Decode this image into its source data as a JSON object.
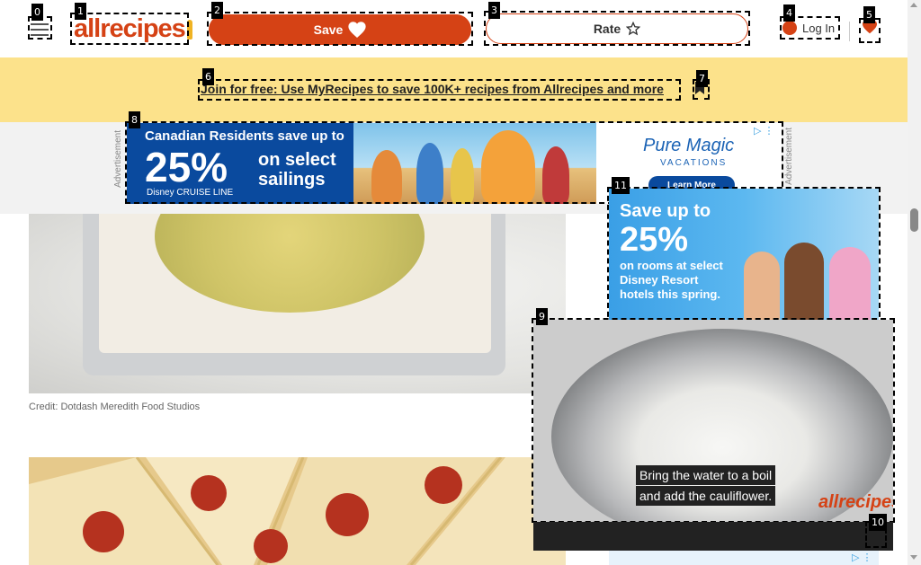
{
  "header": {
    "logo_text": "allrecipes",
    "save_label": "Save",
    "rate_label": "Rate",
    "login_label": "Log In"
  },
  "banner": {
    "link_text": "Join for free: Use MyRecipes to save 100K+ recipes from Allrecipes and more"
  },
  "ads": {
    "label": "Advertisement",
    "leaderboard": {
      "headline": "Canadian Residents save up to",
      "percent": "25%",
      "offer": "on select sailings",
      "brand": "Disney CRUISE LINE",
      "partner": "Pure Magic",
      "partner_sub": "VACATIONS",
      "cta": "Learn More"
    },
    "sidebar": {
      "line1": "Save up to",
      "percent": "25%",
      "offer": "on rooms at select Disney Resort hotels this spring."
    }
  },
  "content": {
    "credit": "Credit: Dotdash Meredith Food Studios"
  },
  "video": {
    "caption_line1": "Bring the water to a boil",
    "caption_line2": "and add the cauliflower.",
    "brand": "allrecipes"
  },
  "som_tags": [
    "0",
    "1",
    "2",
    "3",
    "4",
    "5",
    "6",
    "7",
    "8",
    "9",
    "10",
    "11"
  ],
  "colors": {
    "brand": "#d54215",
    "banner": "#fce28b",
    "ad_blue": "#0a4a9e"
  }
}
